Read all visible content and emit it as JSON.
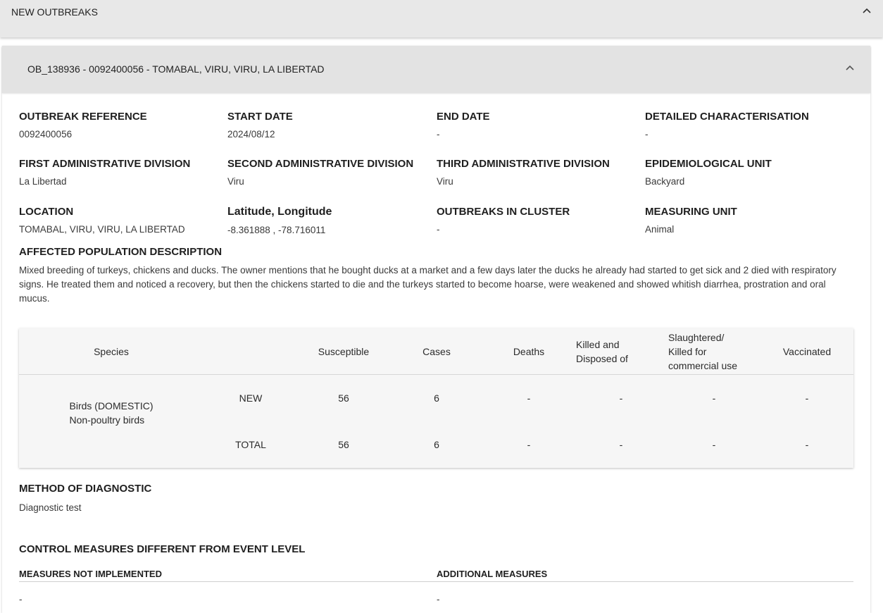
{
  "panel": {
    "title": "NEW OUTBREAKS"
  },
  "outbreak": {
    "header": "OB_138936 - 0092400056 - TOMABAL, VIRU, VIRU, LA LIBERTAD",
    "fields": [
      {
        "label": "OUTBREAK REFERENCE",
        "value": "0092400056"
      },
      {
        "label": "START DATE",
        "value": "2024/08/12"
      },
      {
        "label": "END DATE",
        "value": "-"
      },
      {
        "label": "DETAILED CHARACTERISATION",
        "value": "-"
      },
      {
        "label": "FIRST ADMINISTRATIVE DIVISION",
        "value": "La Libertad"
      },
      {
        "label": "SECOND ADMINISTRATIVE DIVISION",
        "value": "Viru"
      },
      {
        "label": "THIRD ADMINISTRATIVE DIVISION",
        "value": "Viru"
      },
      {
        "label": "EPIDEMIOLOGICAL UNIT",
        "value": "Backyard"
      },
      {
        "label": "LOCATION",
        "value": "TOMABAL, VIRU, VIRU, LA LIBERTAD"
      },
      {
        "label": "Latitude, Longitude",
        "value": "-8.361888 , -78.716011"
      },
      {
        "label": "OUTBREAKS IN CLUSTER",
        "value": "-"
      },
      {
        "label": "MEASURING UNIT",
        "value": "Animal"
      }
    ],
    "affected_population": {
      "label": "AFFECTED POPULATION DESCRIPTION",
      "text": "Mixed breeding of turkeys, chickens and ducks. The owner mentions that he bought ducks at a market and a few days later the ducks he already had started to get sick and 2 died with respiratory signs. He treated them and noticed a recovery, but then the chickens started to die and the turkeys started to become hoarse, were weakened and showed whitish diarrhea, prostration and oral mucus."
    },
    "table": {
      "headers": {
        "species": "Species",
        "susceptible": "Susceptible",
        "cases": "Cases",
        "deaths": "Deaths",
        "killed_line1": "Killed and",
        "killed_line2": "Disposed of",
        "slaughtered_line1": "Slaughtered/",
        "slaughtered_line2": "Killed for",
        "slaughtered_line3": "commercial use",
        "vaccinated": "Vaccinated"
      },
      "species_line1": "Birds (DOMESTIC)",
      "species_line2": "Non-poultry birds",
      "rows": [
        {
          "type": "NEW",
          "susceptible": "56",
          "cases": "6",
          "deaths": "-",
          "killed": "-",
          "slaughtered": "-",
          "vaccinated": "-"
        },
        {
          "type": "TOTAL",
          "susceptible": "56",
          "cases": "6",
          "deaths": "-",
          "killed": "-",
          "slaughtered": "-",
          "vaccinated": "-"
        }
      ]
    },
    "diagnostic": {
      "label": "METHOD OF DIAGNOSTIC",
      "value": "Diagnostic test"
    },
    "control": {
      "label": "CONTROL MEASURES DIFFERENT FROM EVENT LEVEL",
      "not_implemented_label": "MEASURES NOT IMPLEMENTED",
      "not_implemented_value": "-",
      "additional_label": "ADDITIONAL MEASURES",
      "additional_value": "-"
    }
  },
  "icons": {
    "collapse": "chevron-up-icon"
  }
}
